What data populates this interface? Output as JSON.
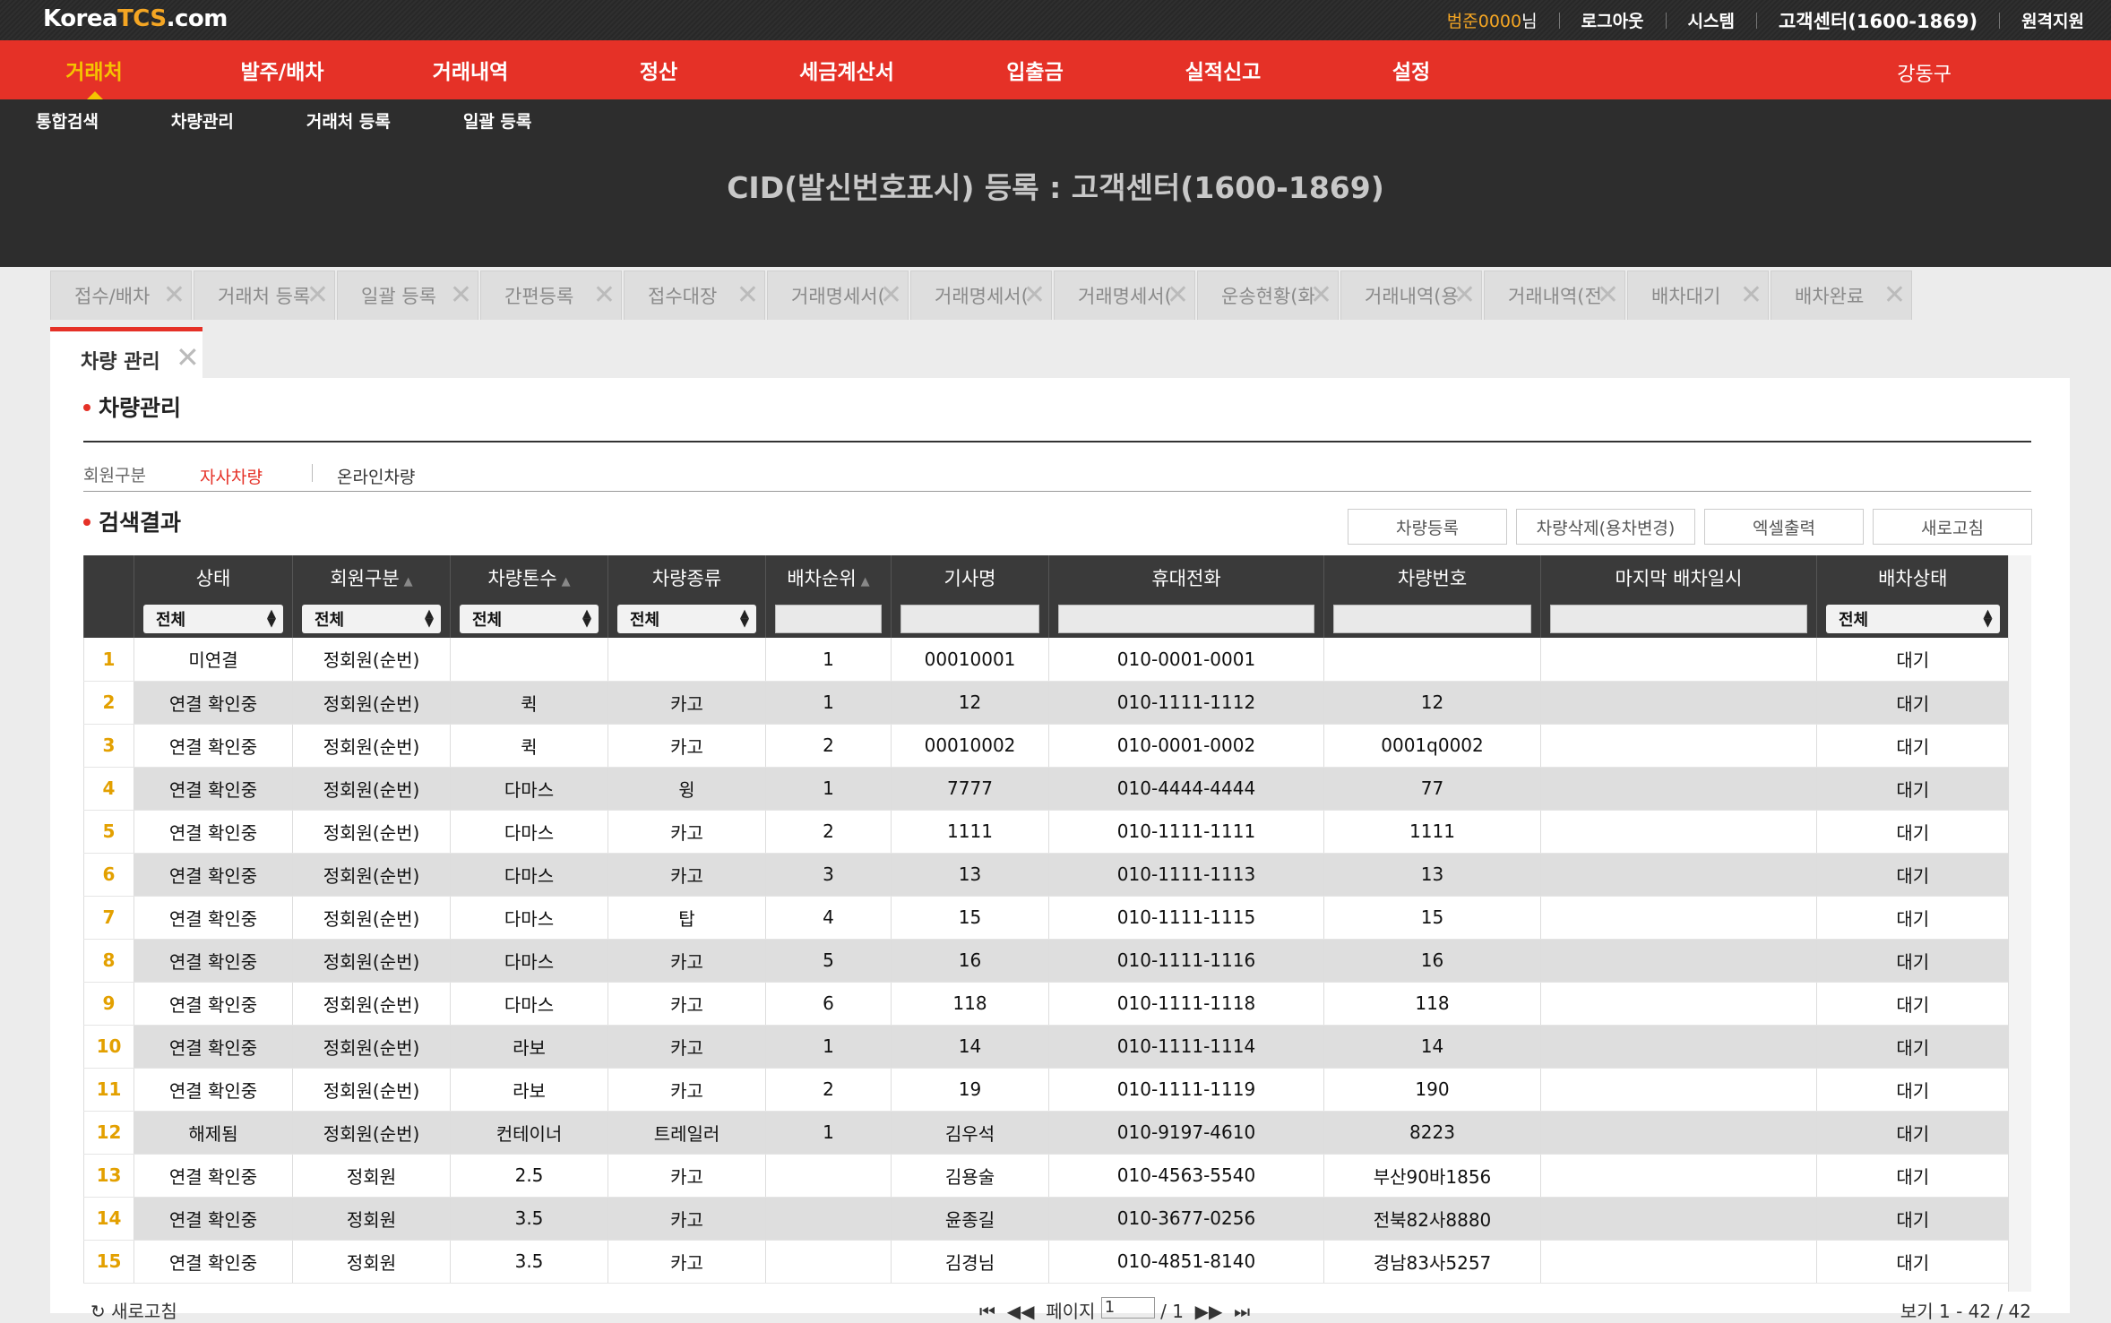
{
  "header": {
    "logo_main": "Korea",
    "logo_accent": "TCS",
    "logo_suffix": ".com",
    "user_name": "범준0000",
    "user_suffix": "님",
    "logout": "로그아웃",
    "system": "시스템",
    "customer_center": "고객센터(1600-1869)",
    "remote_support": "원격지원"
  },
  "main_nav": {
    "items": [
      "거래처",
      "발주/배차",
      "거래내역",
      "정산",
      "세금계산서",
      "입출금",
      "실적신고",
      "설정"
    ],
    "active_index": 0,
    "region": "강동구"
  },
  "sub_nav": [
    "통합검색",
    "차량관리",
    "거래처 등록",
    "일괄 등록"
  ],
  "page_title": "CID(발신번호표시) 등록 : 고객센터(1600-1869)",
  "tabs": [
    "접수/배차",
    "거래처 등록",
    "일괄 등록",
    "간편등록",
    "접수대장",
    "거래명세서(⋯",
    "거래명세서(⋯",
    "거래명세서(⋯",
    "운송현황(화주",
    "거래내역(용차",
    "거래내역(전체",
    "배차대기",
    "배차완료"
  ],
  "tab_close": "✕",
  "active_tab": "차량 관리",
  "section1_title": "차량관리",
  "member_filter": {
    "label": "회원구분",
    "option_selected": "자사차량",
    "option_other": "온라인차량"
  },
  "section2_title": "검색결과",
  "buttons": {
    "register": "차량등록",
    "delete": "차량삭제(용차변경)",
    "excel": "엑셀출력",
    "refresh": "새로고침"
  },
  "table": {
    "columns": [
      "상태",
      "회원구분",
      "차량톤수",
      "차량종류",
      "배차순위",
      "기사명",
      "휴대전화",
      "차량번호",
      "마지막 배차일시",
      "배차상태"
    ],
    "filter_all": "전체",
    "rows": [
      [
        "1",
        "미연결",
        "정회원(순번)",
        "",
        "",
        "1",
        "00010001",
        "010-0001-0001",
        "",
        "",
        "대기"
      ],
      [
        "2",
        "연결 확인중",
        "정회원(순번)",
        "퀵",
        "카고",
        "1",
        "12",
        "010-1111-1112",
        "12",
        "",
        "대기"
      ],
      [
        "3",
        "연결 확인중",
        "정회원(순번)",
        "퀵",
        "카고",
        "2",
        "00010002",
        "010-0001-0002",
        "0001q0002",
        "",
        "대기"
      ],
      [
        "4",
        "연결 확인중",
        "정회원(순번)",
        "다마스",
        "윙",
        "1",
        "7777",
        "010-4444-4444",
        "77",
        "",
        "대기"
      ],
      [
        "5",
        "연결 확인중",
        "정회원(순번)",
        "다마스",
        "카고",
        "2",
        "1111",
        "010-1111-1111",
        "1111",
        "",
        "대기"
      ],
      [
        "6",
        "연결 확인중",
        "정회원(순번)",
        "다마스",
        "카고",
        "3",
        "13",
        "010-1111-1113",
        "13",
        "",
        "대기"
      ],
      [
        "7",
        "연결 확인중",
        "정회원(순번)",
        "다마스",
        "탑",
        "4",
        "15",
        "010-1111-1115",
        "15",
        "",
        "대기"
      ],
      [
        "8",
        "연결 확인중",
        "정회원(순번)",
        "다마스",
        "카고",
        "5",
        "16",
        "010-1111-1116",
        "16",
        "",
        "대기"
      ],
      [
        "9",
        "연결 확인중",
        "정회원(순번)",
        "다마스",
        "카고",
        "6",
        "118",
        "010-1111-1118",
        "118",
        "",
        "대기"
      ],
      [
        "10",
        "연결 확인중",
        "정회원(순번)",
        "라보",
        "카고",
        "1",
        "14",
        "010-1111-1114",
        "14",
        "",
        "대기"
      ],
      [
        "11",
        "연결 확인중",
        "정회원(순번)",
        "라보",
        "카고",
        "2",
        "19",
        "010-1111-1119",
        "190",
        "",
        "대기"
      ],
      [
        "12",
        "해제됨",
        "정회원(순번)",
        "컨테이너",
        "트레일러",
        "1",
        "김우석",
        "010-9197-4610",
        "8223",
        "",
        "대기"
      ],
      [
        "13",
        "연결 확인중",
        "정회원",
        "2.5",
        "카고",
        "",
        "김용술",
        "010-4563-5540",
        "부산90바1856",
        "",
        "대기"
      ],
      [
        "14",
        "연결 확인중",
        "정회원",
        "3.5",
        "카고",
        "",
        "윤종길",
        "010-3677-0256",
        "전북82사8880",
        "",
        "대기"
      ],
      [
        "15",
        "연결 확인중",
        "정회원",
        "3.5",
        "카고",
        "",
        "김경님",
        "010-4851-8140",
        "경남83사5257",
        "",
        "대기"
      ]
    ]
  },
  "pager": {
    "refresh": "↻ 새로고침",
    "page_label": "페이지",
    "page_value": "1",
    "page_total": "/ 1",
    "view": "보기 1 - 42 / 42"
  }
}
